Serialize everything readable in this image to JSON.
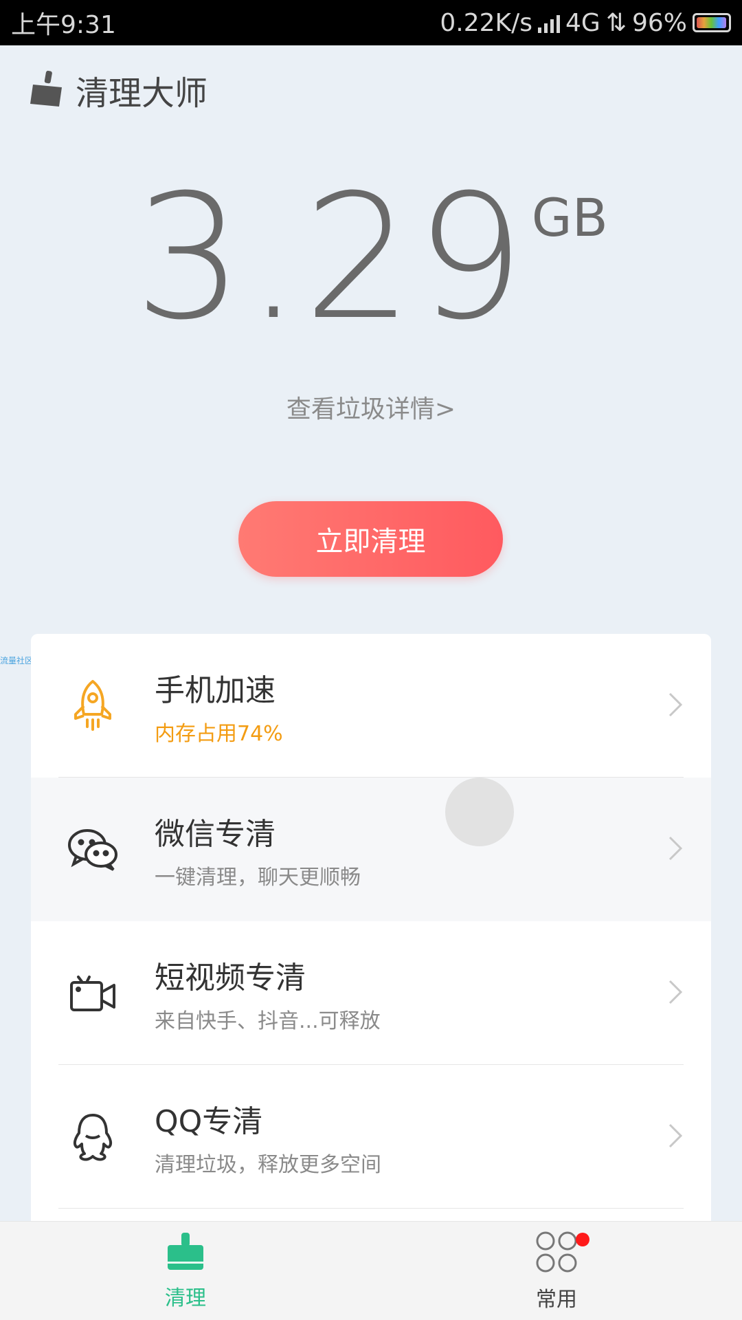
{
  "status_bar": {
    "time": "上午9:31",
    "speed": "0.22K/s",
    "network": "4G",
    "battery": "96%"
  },
  "app": {
    "title": "清理大师",
    "icon": "broom-icon"
  },
  "junk": {
    "size": "3.29",
    "unit": "GB",
    "detail_link": "查看垃圾详情>"
  },
  "clean_button": {
    "label": "立即清理",
    "gradient": [
      "#ff7a73",
      "#ff5a5f"
    ]
  },
  "side_watermark": "流量社区",
  "features": [
    {
      "title": "手机加速",
      "subtitle": "内存占用74%",
      "icon": "rocket-icon",
      "subtitle_color": "#f39c12"
    },
    {
      "title": "微信专清",
      "subtitle": "一键清理，聊天更顺畅",
      "icon": "wechat-icon"
    },
    {
      "title": "短视频专清",
      "subtitle": "来自快手、抖音...可释放",
      "icon": "video-camera-icon"
    },
    {
      "title": "QQ专清",
      "subtitle": "清理垃圾，释放更多空间",
      "icon": "qq-penguin-icon"
    }
  ],
  "bottom_nav": {
    "items": [
      {
        "label": "清理",
        "icon": "broom-icon",
        "active": true
      },
      {
        "label": "常用",
        "icon": "apps-grid-icon",
        "active": false,
        "badge": true
      }
    ],
    "active_color": "#2bbf8a",
    "badge_color": "#ff1a1a"
  }
}
